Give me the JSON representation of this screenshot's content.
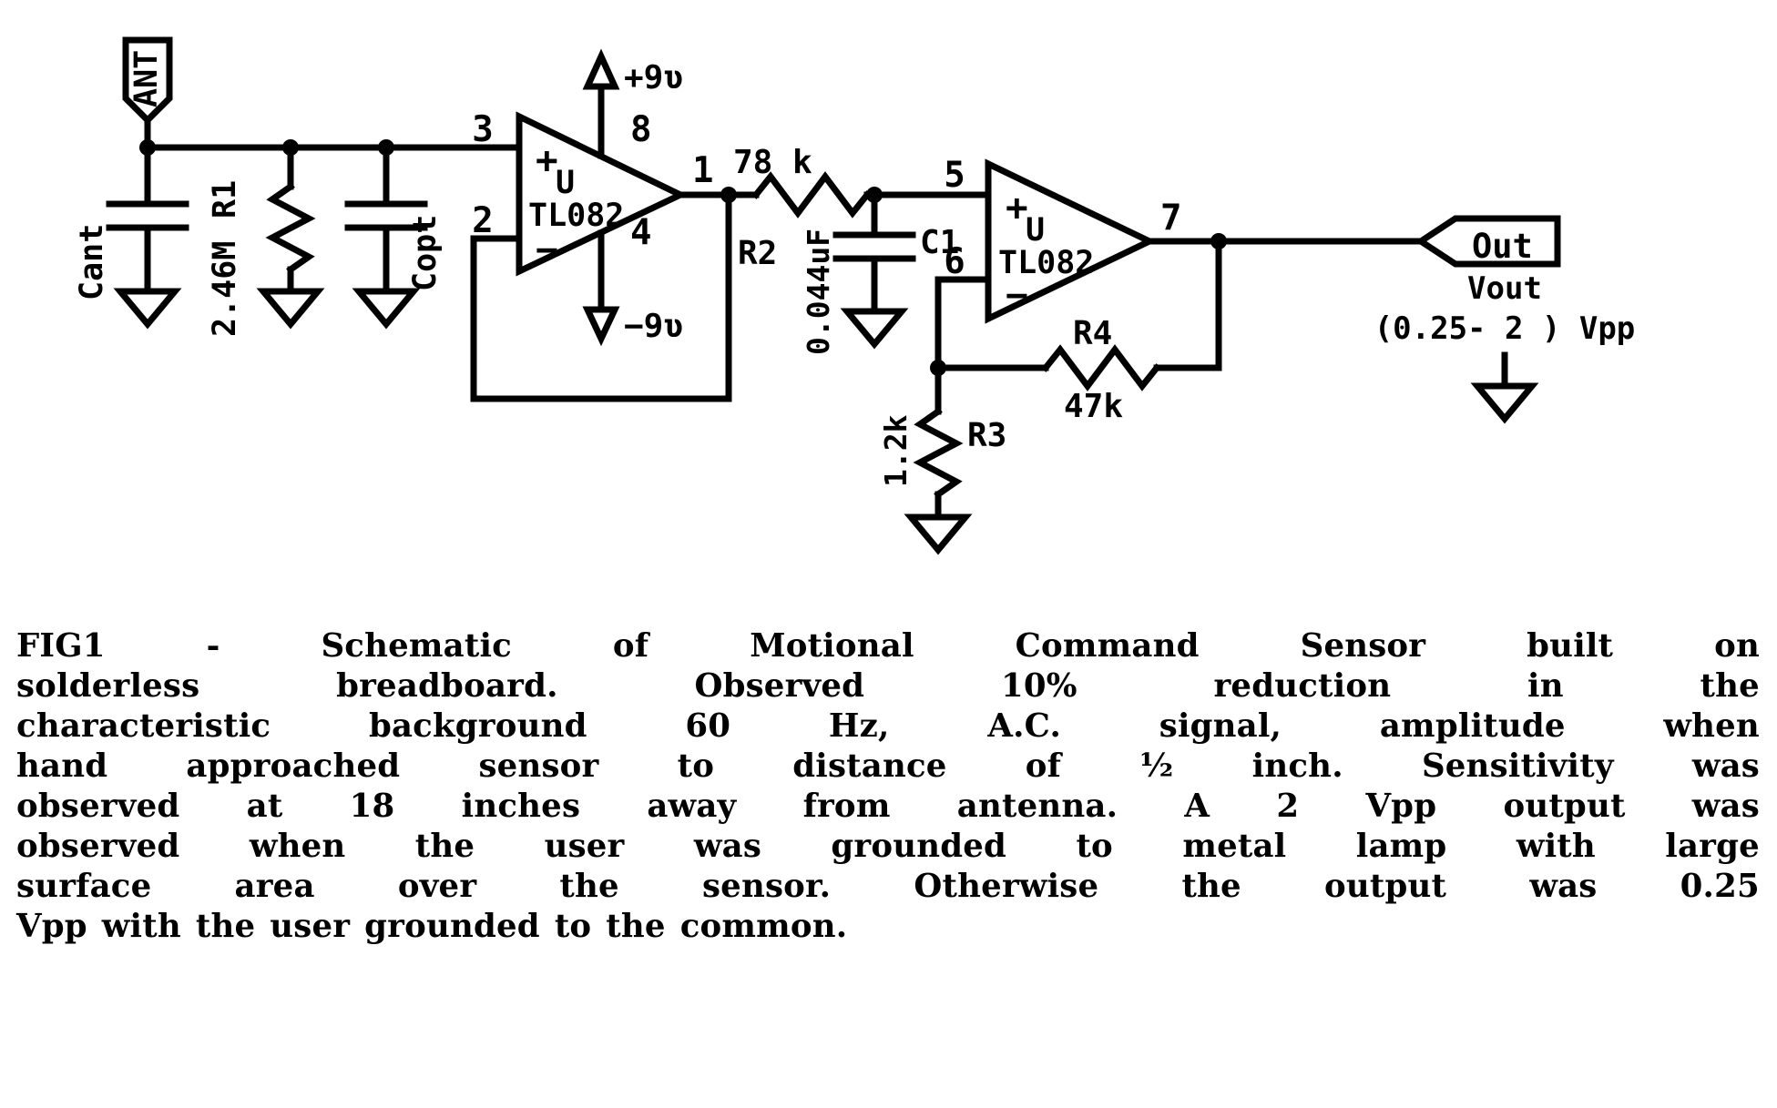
{
  "figure": {
    "title_id": "FIG1",
    "type": "electronic-schematic"
  },
  "schematic": {
    "antenna": {
      "label": "ANT"
    },
    "components": [
      {
        "ref": "Cant",
        "type": "capacitor",
        "value": ""
      },
      {
        "ref": "R1",
        "type": "resistor",
        "value": "2.46M"
      },
      {
        "ref": "Copt",
        "type": "capacitor",
        "value": ""
      },
      {
        "ref": "R2",
        "type": "resistor",
        "value": "78 k"
      },
      {
        "ref": "C1",
        "type": "capacitor",
        "value": "0.044uF"
      },
      {
        "ref": "R3",
        "type": "resistor",
        "value": "1.2k"
      },
      {
        "ref": "R4",
        "type": "resistor",
        "value": "47k"
      }
    ],
    "opamp1": {
      "device": "TL082",
      "prefix": "U",
      "pin_noninv": "3",
      "pin_inv": "2",
      "pin_out": "1",
      "pin_vpos": "8",
      "pin_vneg": "4",
      "plus": "+",
      "minus": "−",
      "supply_pos": "+9ʋ",
      "supply_neg": "−9ʋ"
    },
    "opamp2": {
      "device": "TL082",
      "prefix": "U",
      "pin_noninv": "5",
      "pin_inv": "6",
      "pin_out": "7",
      "plus": "+",
      "minus": "−"
    },
    "output": {
      "port_label": "Out",
      "net_name": "Vout",
      "range": "(0.25- 2 ) Vpp"
    },
    "labels": {
      "cant": "Cant",
      "r1_ref": "R1",
      "r1_val": "2.46M",
      "copt": "Copt",
      "r2_ref": "R2",
      "r2_val": "78 k",
      "c1_ref": "C1",
      "c1_val": "0.044uF",
      "r3_ref": "R3",
      "r3_val": "1.2k",
      "r4_ref": "R4",
      "r4_val": "47k"
    }
  },
  "caption": {
    "lines": [
      [
        "FIG1",
        "-",
        "Schematic",
        "of",
        "Motional",
        "Command",
        "Sensor",
        "built",
        "on"
      ],
      [
        "solderless",
        "breadboard.",
        "Observed",
        "10%",
        "reduction",
        "in",
        "the"
      ],
      [
        "characteristic",
        "background",
        "60",
        "Hz,",
        "A.C.",
        "signal,",
        "amplitude",
        "when"
      ],
      [
        "hand",
        "approached",
        "sensor",
        "to",
        "distance",
        "of",
        "½",
        "inch.",
        "Sensitivity",
        "was"
      ],
      [
        "observed",
        "at",
        "18",
        "inches",
        "away",
        "from",
        "antenna.",
        "A",
        "2",
        "Vpp",
        "output",
        "was"
      ],
      [
        "observed",
        "when",
        "the",
        "user",
        "was",
        "grounded",
        "to",
        "metal",
        "lamp",
        "with",
        "large"
      ],
      [
        "surface",
        "area",
        "over",
        "the",
        "sensor.",
        "Otherwise",
        "the",
        "output",
        "was",
        "0.25"
      ],
      [
        "Vpp",
        "with",
        "the",
        "user",
        "grounded",
        "to",
        "the",
        "common."
      ]
    ],
    "last_line_index": 7
  },
  "colors": {
    "ink": "#000000",
    "paper": "#ffffff"
  }
}
